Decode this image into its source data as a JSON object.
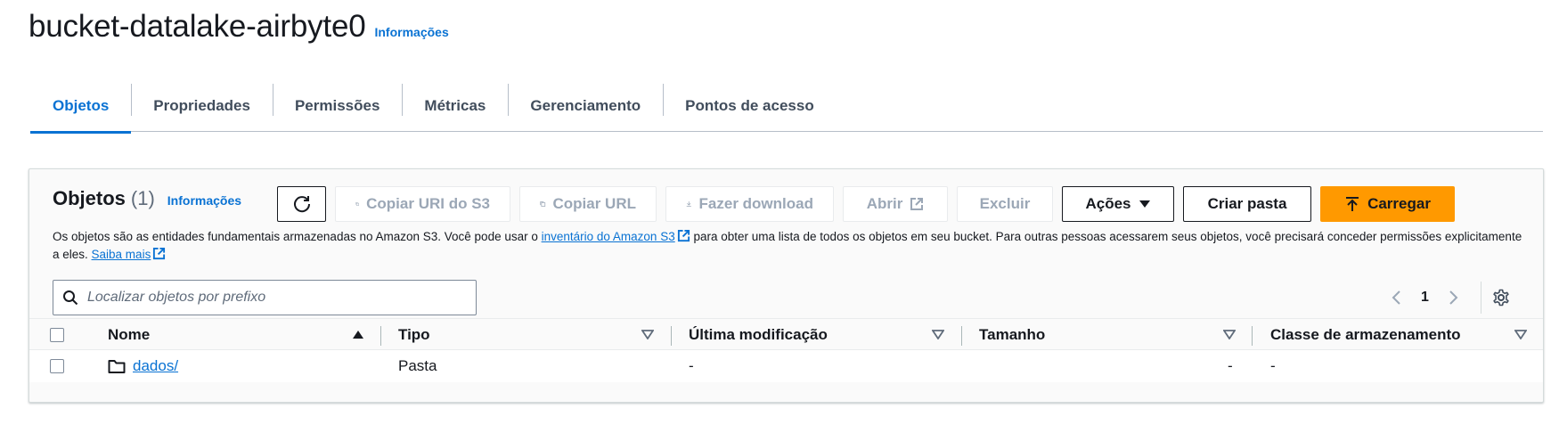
{
  "header": {
    "bucket_name": "bucket-datalake-airbyte0",
    "info_link": "Informações"
  },
  "tabs": [
    {
      "label": "Objetos",
      "active": true
    },
    {
      "label": "Propriedades"
    },
    {
      "label": "Permissões"
    },
    {
      "label": "Métricas"
    },
    {
      "label": "Gerenciamento"
    },
    {
      "label": "Pontos de acesso"
    }
  ],
  "objects_panel": {
    "title": "Objetos",
    "count": "(1)",
    "info_link": "Informações",
    "toolbar": {
      "refresh_icon": "refresh-icon",
      "copy_s3_uri": "Copiar URI do S3",
      "copy_url": "Copiar URL",
      "download": "Fazer download",
      "open": "Abrir",
      "delete": "Excluir",
      "actions": "Ações",
      "create_folder": "Criar pasta",
      "upload": "Carregar"
    },
    "description": {
      "part1": "Os objetos são as entidades fundamentais armazenadas no Amazon S3. Você pode usar o ",
      "inventory_link": "inventário do Amazon S3",
      "part2": " para obter uma lista de todos os objetos em seu bucket. Para outras pessoas acessarem seus objetos, você precisará conceder permissões explicitamente a eles. ",
      "learn_more_link": "Saiba mais"
    },
    "search": {
      "placeholder": "Localizar objetos por prefixo",
      "value": ""
    },
    "pagination": {
      "current_page": "1"
    },
    "table": {
      "columns": [
        "Nome",
        "Tipo",
        "Última modificação",
        "Tamanho",
        "Classe de armazenamento"
      ],
      "rows": [
        {
          "name": "dados/",
          "type": "Pasta",
          "last_modified": "-",
          "size": "-",
          "storage_class": "-"
        }
      ]
    }
  },
  "colors": {
    "link": "#0972d3",
    "primary_button": "#ff9900",
    "disabled_text": "#9ba7b6"
  }
}
